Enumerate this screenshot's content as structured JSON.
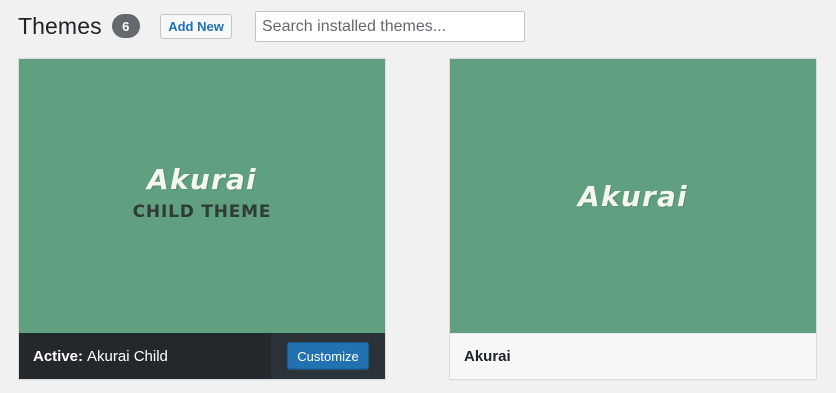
{
  "header": {
    "title": "Themes",
    "count": "6",
    "add_new_label": "Add New",
    "search_placeholder": "Search installed themes..."
  },
  "colors": {
    "screenshot_bg": "#60a080",
    "active_bar_bg": "#23282d",
    "button_blue": "#2271b1"
  },
  "themes": [
    {
      "screenshot_title": "Akurai",
      "screenshot_subtitle": "CHILD THEME",
      "active_prefix": "Active:",
      "name": "Akurai Child",
      "action_label": "Customize"
    },
    {
      "screenshot_title": "Akurai",
      "name": "Akurai"
    }
  ]
}
